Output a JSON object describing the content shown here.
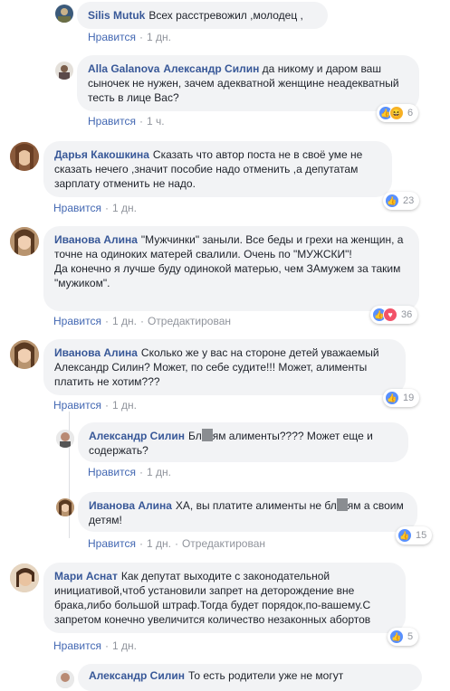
{
  "reactions": {
    "like": "👍",
    "love": "♥",
    "haha": "😆"
  },
  "comments": [
    {
      "author": "Silis Mutuk",
      "text": "Всех расстревожил ,молодец ,",
      "like": "Нравится",
      "time": "1 дн."
    },
    {
      "author": "Alla Galanova",
      "mention": "Александр Силин",
      "text": " да никому и даром ваш сыночек не нужен, зачем адекватной женщине неадекватный тесть в лице Вас?",
      "like": "Нравится",
      "time": "1 ч.",
      "count": "6"
    },
    {
      "author": "Дарья Какошкина",
      "text": "Сказать что автор поста не в своё уме не сказать нечего ,значит пособие надо отменить ,а депутатам зарплату отменить не надо.",
      "like": "Нравится",
      "time": "1 дн.",
      "count": "23"
    },
    {
      "author": "Иванова Алина",
      "text": "\"Мужчинки\" заныли. Все беды и грехи на женщин, а точне на одиноких матерей свалили. Очень по \"МУЖСКИ\"!",
      "text2": "Да конечно я лучше буду одинокой матерью, чем ЗАмужем за таким \"мужиком\".",
      "like": "Нравится",
      "time": "1 дн.",
      "edited": "Отредактирован",
      "count": "36"
    },
    {
      "author": "Иванова Алина",
      "text": "Сколько же у вас на стороне детей уважаемый Александр Силин? Может, по себе судите!!! Может, алименты платить не хотим???",
      "like": "Нравится",
      "time": "1 дн.",
      "count": "19"
    },
    {
      "author": "Александр Силин",
      "text_a": "Бл",
      "text_b": "ям алименты???? Может еще и содержать?",
      "like": "Нравится",
      "time": "1 дн."
    },
    {
      "author": "Иванова Алина",
      "text_a": "ХА, вы платите алименты не бл",
      "text_b": "ям а своим детям!",
      "like": "Нравится",
      "time": "1 дн.",
      "edited": "Отредактирован",
      "count": "15"
    },
    {
      "author": "Мари Аснат",
      "text": "Как депутат выходите с законодательной инициативой,чтоб установили запрет на деторождение вне брака,либо большой штраф.Тогда будет порядок,по-вашему.С запретом конечно увеличится количество незаконных абортов",
      "like": "Нравится",
      "time": "1 дн.",
      "count": "5"
    },
    {
      "author": "Александр Силин",
      "text": "То есть родители уже не могут"
    }
  ]
}
